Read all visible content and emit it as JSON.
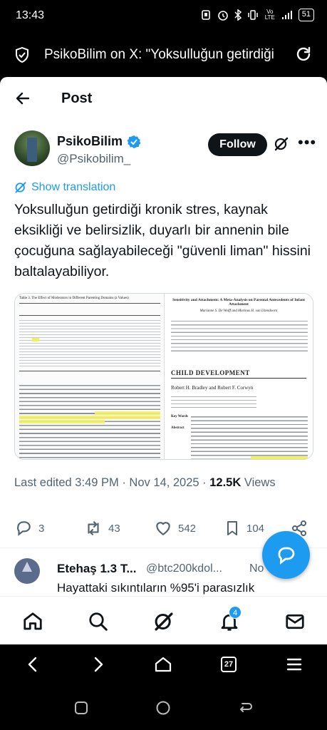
{
  "status": {
    "time": "13:43",
    "battery": "51",
    "network_label": "Vo LTE"
  },
  "browser": {
    "tab_title": "PsikoBilim on X: \"Yoksulluğun getirdiği"
  },
  "topnav": {
    "title": "Post"
  },
  "author": {
    "name": "PsikoBilim",
    "handle": "@Psikobilim_",
    "follow_label": "Follow"
  },
  "post": {
    "show_translation": "Show translation",
    "text": "Yoksulluğun getirdiği kronik stres, kaynak eksikliği ve belirsizlik, duyarlı bir annenin bile çocuğuna sağlayabileceği \"güvenli liman\" hissini baltalayabiliyor.",
    "edited_time": "Last edited 3:49 PM · Nov 14, 2025 · ",
    "views_value": "12.5K",
    "views_label": " Views"
  },
  "media": {
    "left_heading": "Table 3. The Effect of Moderators in Different Parenting Domains (z Values)",
    "right_title": "Sensitivity and Attachment: A Meta-Analysis on Parental Antecedents of Infant Attachment",
    "right_authors": "Marianne S. De Wolff and Marinus H. van IJzendoorn",
    "journal": "CHILD DEVELOPMENT",
    "right_authors2": "Robert H. Bradley and Robert F. Corwyn",
    "key_words": "Key Words",
    "abstract": "Abstract"
  },
  "actions": {
    "replies": "3",
    "reposts": "43",
    "likes": "542",
    "bookmarks": "104"
  },
  "reply": {
    "name": "Etehaş 1.3 T...",
    "handle": "@btc200kdol...",
    "time": "No",
    "text": "Hayattaki sıkıntıların %95'i parasızlık"
  },
  "tabbar": {
    "notifications_badge": "4"
  },
  "browsernav": {
    "tabs_count": "27"
  },
  "colors": {
    "accent": "#1d9bf0",
    "text": "#0f1419",
    "muted": "#536471"
  }
}
